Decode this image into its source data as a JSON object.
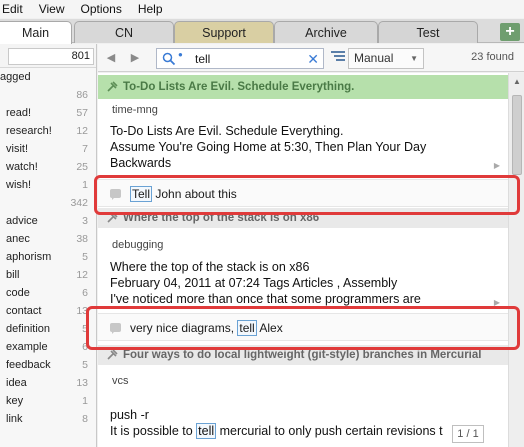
{
  "menu": [
    "Edit",
    "View",
    "Options",
    "Help"
  ],
  "tabs": {
    "main": "Main",
    "cn": "CN",
    "support": "Support",
    "archive": "Archive",
    "test": "Test",
    "add": "+"
  },
  "left": {
    "total_count": "801",
    "rows_top": [
      {
        "label": "agged",
        "count": ""
      },
      {
        "label": "",
        "count": "86"
      },
      {
        "label": "read!",
        "count": "57"
      },
      {
        "label": "research!",
        "count": "12"
      },
      {
        "label": "visit!",
        "count": "7"
      },
      {
        "label": "watch!",
        "count": "25"
      },
      {
        "label": "wish!",
        "count": "1"
      }
    ],
    "tags_count": "342",
    "rows_tags": [
      {
        "label": "advice",
        "count": "3"
      },
      {
        "label": "anec",
        "count": "38"
      },
      {
        "label": "aphorism",
        "count": "5"
      },
      {
        "label": "bill",
        "count": "12"
      },
      {
        "label": "code",
        "count": "6"
      },
      {
        "label": "contact",
        "count": "13"
      },
      {
        "label": "definition",
        "count": "5"
      },
      {
        "label": "example",
        "count": "6"
      },
      {
        "label": "feedback",
        "count": "5"
      },
      {
        "label": "idea",
        "count": "13"
      },
      {
        "label": "key",
        "count": "1"
      },
      {
        "label": "link",
        "count": "8"
      }
    ]
  },
  "toolbar": {
    "search_value": "tell",
    "sort_value": "Manual",
    "found": "23 found"
  },
  "notes": [
    {
      "title": "To-Do Lists Are Evil. Schedule Everything.",
      "tag": "time-mng",
      "body": [
        "To-Do Lists Are Evil. Schedule Everything.",
        "Assume You're Going Home at 5:30, Then Plan Your Day",
        "Backwards"
      ],
      "comment_pre": "",
      "comment_hl": "Tell",
      "comment_post": " John about this"
    },
    {
      "title": "Where the top of the stack is on x86",
      "tag": "debugging",
      "body": [
        "Where the top of the stack is on x86",
        " February 04, 2011 at 07:24 Tags Articles , Assembly",
        "I've noticed more than once that some programmers are"
      ],
      "comment_pre": "very nice diagrams, ",
      "comment_hl": "tell",
      "comment_post": " Alex"
    },
    {
      "title": "Four ways to do local lightweight (git-style) branches in Mercurial",
      "tag": "vcs",
      "body": [
        "push -r",
        "It is possible to ",
        "tell",
        " mercurial to only push certain revisions t"
      ]
    }
  ],
  "pager": "1 / 1",
  "colors": {
    "accent_green": "#b6e0ab",
    "highlight_border": "#6aa2d4",
    "red_annotation": "#e03a3a"
  }
}
